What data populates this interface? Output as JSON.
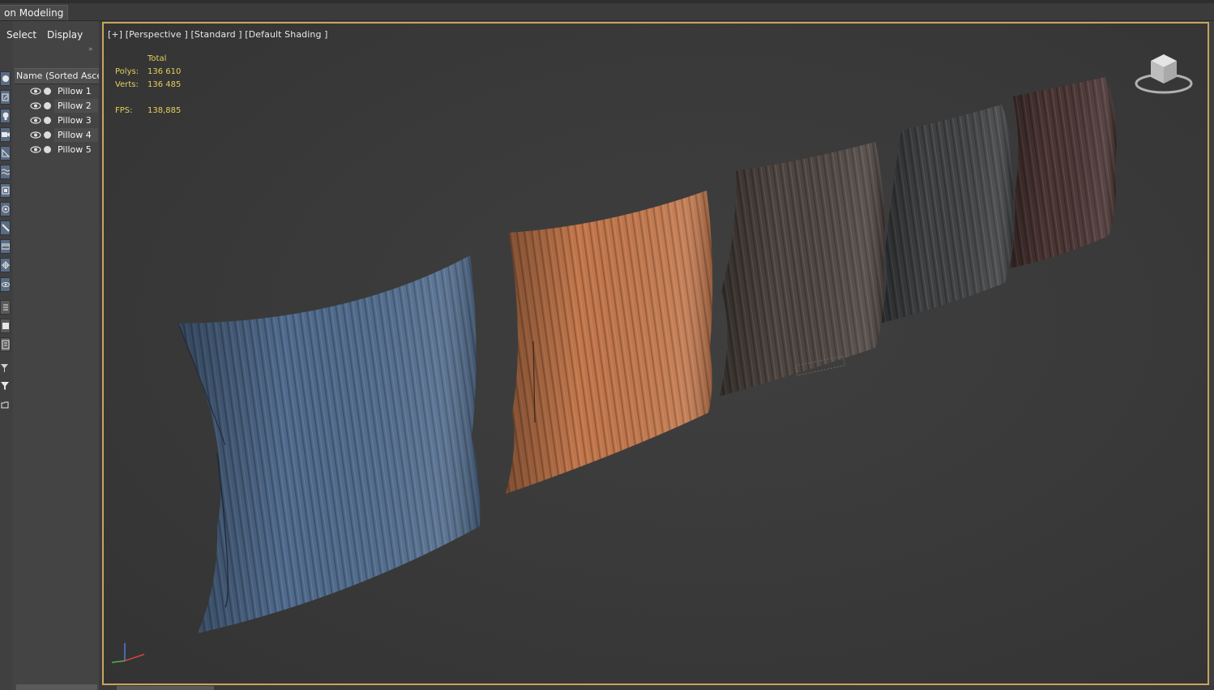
{
  "ribbon": {
    "active_tab": "on Modeling"
  },
  "explorer": {
    "menu": {
      "select": "Select",
      "display": "Display"
    },
    "column_header": "Name (Sorted Ascending)",
    "items": [
      {
        "label": "Pillow 1"
      },
      {
        "label": "Pillow 2"
      },
      {
        "label": "Pillow 3"
      },
      {
        "label": "Pillow 4"
      },
      {
        "label": "Pillow 5"
      }
    ]
  },
  "viewport": {
    "label": "[+] [Perspective ] [Standard ] [Default Shading ]",
    "stats": {
      "total_label": "Total",
      "polys_label": "Polys:",
      "polys_value": "136 610",
      "verts_label": "Verts:",
      "verts_value": "136 485",
      "fps_label": "FPS:",
      "fps_value": "138,885"
    },
    "active_border_color": "#c8a55a"
  },
  "pillows": [
    {
      "name": "Pillow 1",
      "color": "#4f6a8c"
    },
    {
      "name": "Pillow 2",
      "color": "#c2764a"
    },
    {
      "name": "Pillow 3",
      "color": "#4e4540"
    },
    {
      "name": "Pillow 4",
      "color": "#3f4143"
    },
    {
      "name": "Pillow 5",
      "color": "#4a3533"
    }
  ]
}
